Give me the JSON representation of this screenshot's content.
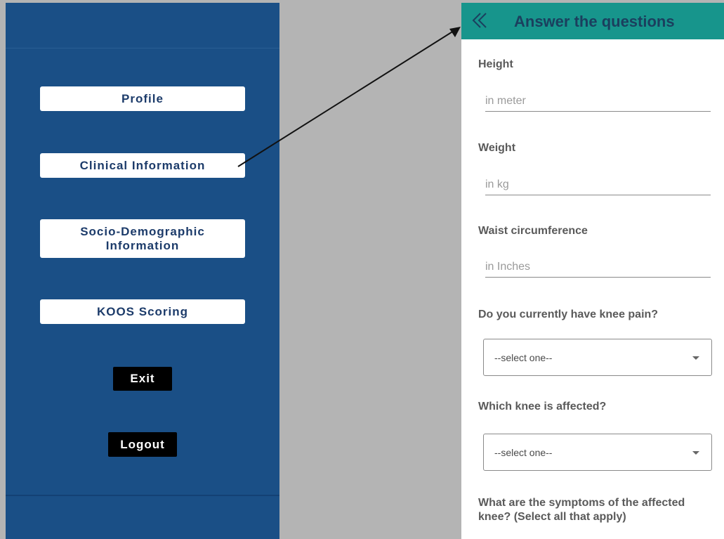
{
  "menu": {
    "profile_label": "Profile",
    "clinical_label": "Clinical Information",
    "socio_label": "Socio-Demographic\nInformation",
    "koos_label": "KOOS Scoring",
    "exit_label": "Exit",
    "logout_label": "Logout"
  },
  "form": {
    "header_title": "Answer the questions",
    "height_label": "Height",
    "height_placeholder": "in meter",
    "weight_label": "Weight",
    "weight_placeholder": "in kg",
    "waist_label": "Waist circumference",
    "waist_placeholder": "in Inches",
    "knee_pain_label": "Do you currently have knee pain?",
    "knee_pain_value": "--select one--",
    "affected_knee_label": "Which knee is affected?",
    "affected_knee_value": "--select one--",
    "symptoms_label": "What are the symptoms of the affected knee? (Select all that apply)"
  },
  "colors": {
    "menu_bg": "#1a4f86",
    "header_bg": "#17958c",
    "backdrop": "#b4b4b4"
  },
  "icons": {
    "back": "double-chevron-left-icon",
    "dropdown": "caret-down-icon"
  }
}
